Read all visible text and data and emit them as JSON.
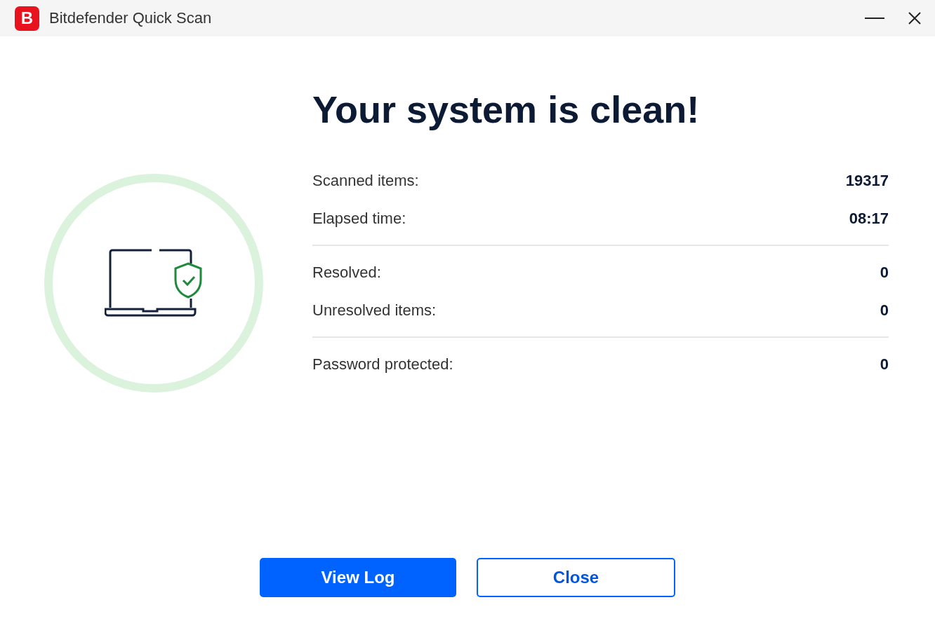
{
  "window": {
    "title": "Bitdefender Quick Scan",
    "logo": "B"
  },
  "heading": "Your system is clean!",
  "sections": [
    {
      "rows": [
        {
          "label": "Scanned items:",
          "value": "19317"
        },
        {
          "label": "Elapsed time:",
          "value": "08:17"
        }
      ]
    },
    {
      "rows": [
        {
          "label": "Resolved:",
          "value": "0"
        },
        {
          "label": "Unresolved items:",
          "value": "0"
        }
      ]
    },
    {
      "rows": [
        {
          "label": "Password protected:",
          "value": "0"
        }
      ]
    }
  ],
  "buttons": [
    {
      "label": "View Log",
      "kind": "primary"
    },
    {
      "label": "Close",
      "kind": "secondary"
    }
  ]
}
